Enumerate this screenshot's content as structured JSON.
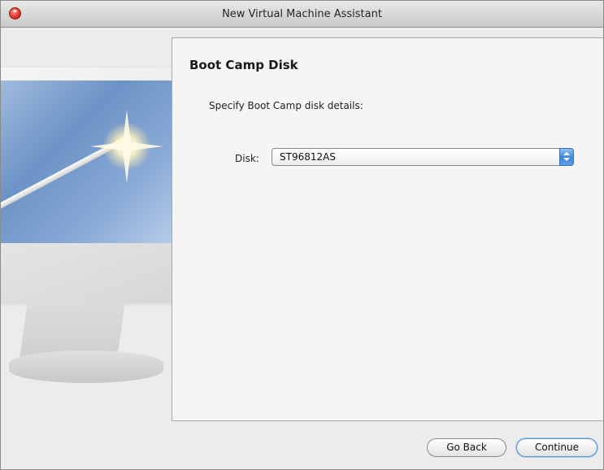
{
  "window": {
    "title": "New Virtual Machine Assistant"
  },
  "page": {
    "heading": "Boot Camp Disk",
    "prompt": "Specify Boot Camp disk details:"
  },
  "disk": {
    "label": "Disk:",
    "selected": "ST96812AS"
  },
  "buttons": {
    "back": "Go Back",
    "continue": "Continue"
  },
  "colors": {
    "accent": "#3b86dc",
    "close": "#e8433a"
  }
}
